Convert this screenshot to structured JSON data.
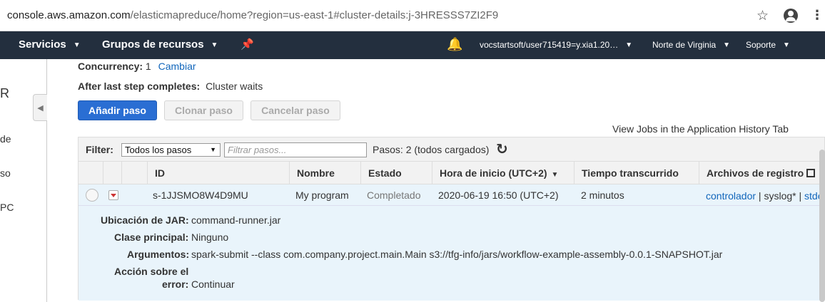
{
  "browser": {
    "url_host": "console.aws.amazon.com",
    "url_rest": "/elasticmapreduce/home?region=us-east-1#cluster-details:j-3HRESSS7ZI2F9"
  },
  "nav": {
    "services": "Servicios",
    "resource_groups": "Grupos de recursos",
    "account": "vocstartsoft/user715419=y.xia1.20…",
    "region": "Norte de Virginia",
    "support": "Soporte"
  },
  "sidebar": {
    "items": [
      "R",
      "de",
      "so",
      "PC"
    ]
  },
  "cluster": {
    "concurrency_label": "Concurrency:",
    "concurrency_value": "1",
    "change_link": "Cambiar",
    "after_label": "After last step completes:",
    "after_value": "Cluster waits"
  },
  "buttons": {
    "add_step": "Añadir paso",
    "clone_step": "Clonar paso",
    "cancel_step": "Cancelar paso"
  },
  "history_link": "View Jobs in the Application History Tab",
  "filter": {
    "label": "Filter:",
    "selected": "Todos los pasos",
    "placeholder": "Filtrar pasos...",
    "count_text": "Pasos: 2 (todos cargados)"
  },
  "table": {
    "headers": {
      "id": "ID",
      "name": "Nombre",
      "status": "Estado",
      "start_time": "Hora de inicio (UTC+2)",
      "elapsed": "Tiempo transcurrido",
      "logs": "Archivos de registro"
    },
    "rows": [
      {
        "id": "s-1JJSMO8W4D9MU",
        "name": "My program",
        "status": "Completado",
        "start_time": "2020-06-19 16:50 (UTC+2)",
        "elapsed": "2 minutos",
        "log_controller": "controlador",
        "log_sep1": " | ",
        "log_syslog": "syslog*",
        "log_sep2": " | ",
        "log_stderr": "stde"
      }
    ]
  },
  "details": {
    "jar_label": "Ubicación de JAR:",
    "jar_value": "command-runner.jar",
    "main_class_label": "Clase principal:",
    "main_class_value": "Ninguno",
    "args_label": "Argumentos:",
    "args_value": "spark-submit --class com.company.project.main.Main s3://tfg-info/jars/workflow-example-assembly-0.0.1-SNAPSHOT.jar",
    "failure_label_1": "Acción sobre el",
    "failure_label_2": "error:",
    "failure_value": "Continuar"
  }
}
